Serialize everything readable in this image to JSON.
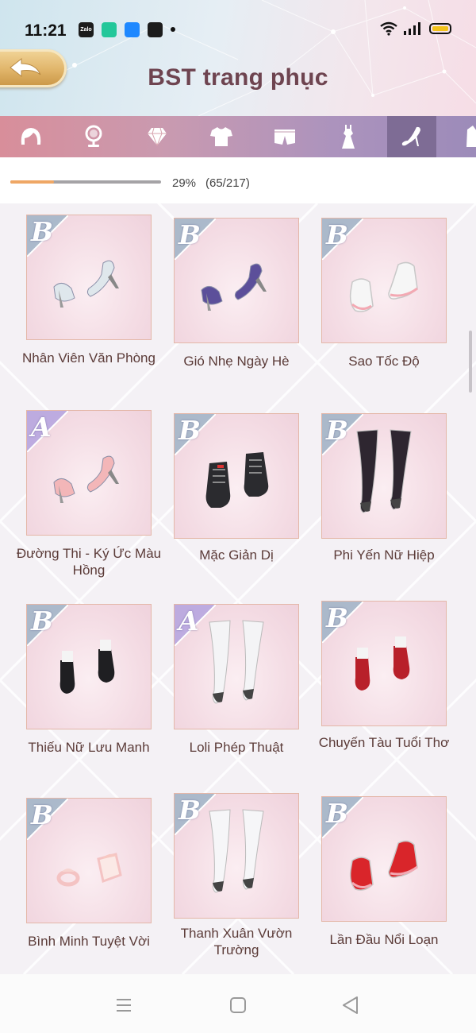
{
  "status_bar": {
    "time": "11:21",
    "apps": [
      {
        "icon": "zalo-icon",
        "label": "Zalo",
        "color": "#1c1c1c"
      },
      {
        "icon": "calc-app-icon",
        "label": "",
        "color": "#23c79a"
      },
      {
        "icon": "messenger-app-icon",
        "label": "",
        "color": "#1e88ff"
      },
      {
        "icon": "capcut-icon",
        "label": "",
        "color": "#1c1c1c"
      }
    ]
  },
  "header": {
    "title": "BST trang phục",
    "back_icon": "back-arrow-icon"
  },
  "tabs": [
    {
      "icon": "hair-icon",
      "active": false
    },
    {
      "icon": "mirror-icon",
      "active": false
    },
    {
      "icon": "diamond-icon",
      "active": false
    },
    {
      "icon": "shirt-icon",
      "active": false
    },
    {
      "icon": "shorts-icon",
      "active": false
    },
    {
      "icon": "dress-icon",
      "active": false
    },
    {
      "icon": "heel-shoe-icon",
      "active": true
    },
    {
      "icon": "coat-icon",
      "active": false
    }
  ],
  "progress": {
    "fraction": 0.29,
    "percent_label": "29%",
    "count_label": "(65/217)"
  },
  "items": [
    {
      "rank": "B",
      "name": "Nhân Viên Văn Phòng",
      "shoe": "heels",
      "color": "#dfe7ec"
    },
    {
      "rank": "B",
      "name": "Gió Nhẹ Ngày Hè",
      "shoe": "heels",
      "color": "#5c4f9a"
    },
    {
      "rank": "B",
      "name": "Sao Tốc Độ",
      "shoe": "sneaker",
      "color": "#f6f6f6"
    },
    {
      "rank": "A",
      "name": "Đường Thi - Ký Ức Màu Hồng",
      "shoe": "heels",
      "color": "#f3b6b8"
    },
    {
      "rank": "B",
      "name": "Mặc Giản Dị",
      "shoe": "boot",
      "color": "#2b2b2f"
    },
    {
      "rank": "B",
      "name": "Phi Yến Nữ Hiệp",
      "shoe": "stocking",
      "color": "#2e2630"
    },
    {
      "rank": "B",
      "name": "Thiếu Nữ Lưu Manh",
      "shoe": "loafer",
      "color": "#1f1f22"
    },
    {
      "rank": "A",
      "name": "Loli Phép Thuật",
      "shoe": "stocking",
      "color": "#f4f4f6"
    },
    {
      "rank": "B",
      "name": "Chuyến Tàu Tuổi Thơ",
      "shoe": "loafer",
      "color": "#b8202a"
    },
    {
      "rank": "B",
      "name": "Bình Minh Tuyệt Vời",
      "shoe": "sandal",
      "color": "#f4c3c3"
    },
    {
      "rank": "B",
      "name": "Thanh Xuân Vườn Trường",
      "shoe": "stocking",
      "color": "#f6f6f8"
    },
    {
      "rank": "B",
      "name": "Lần Đầu Nổi Loạn",
      "shoe": "sneaker",
      "color": "#d9252a"
    }
  ],
  "nav": [
    {
      "icon": "recent-apps-icon"
    },
    {
      "icon": "home-icon"
    },
    {
      "icon": "back-triangle-icon"
    }
  ]
}
